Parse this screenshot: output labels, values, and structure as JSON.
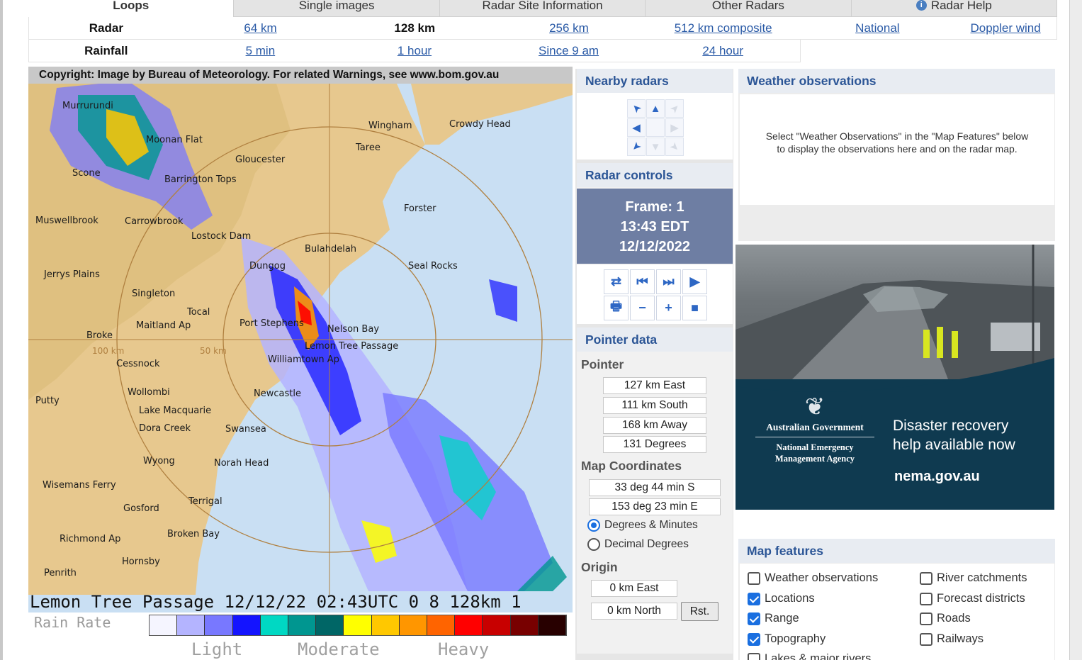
{
  "tabs": [
    {
      "label": "Loops",
      "active": true
    },
    {
      "label": "Single images",
      "active": false
    },
    {
      "label": "Radar Site Information",
      "active": false
    },
    {
      "label": "Other Radars",
      "active": false
    },
    {
      "label": "Radar Help",
      "active": false,
      "icon": "info-icon"
    }
  ],
  "radar_row": {
    "label": "Radar",
    "options": [
      "64 km",
      "128 km",
      "256 km",
      "512 km composite",
      "National",
      "Doppler wind"
    ],
    "current": "128 km"
  },
  "rainfall_row": {
    "label": "Rainfall",
    "options": [
      "5 min",
      "1 hour",
      "Since 9 am",
      "24 hour"
    ]
  },
  "radar_image": {
    "copyright": "Copyright: Image by Bureau of Meteorology. For related Warnings, see www.bom.gov.au",
    "footer": "Lemon Tree Passage 12/12/22 02:43UTC 0 8 128km 1",
    "range_labels": [
      "100 km",
      "50 km"
    ],
    "places": [
      "Murrurundi",
      "Moonan Flat",
      "Scone",
      "Barrington Tops",
      "Gloucester",
      "Wingham",
      "Taree",
      "Crowdy Head",
      "Forster",
      "Muswellbrook",
      "Carrowbrook",
      "Lostock Dam",
      "Bulahdelah",
      "Seal Rocks",
      "Jerrys Plains",
      "Dungog",
      "Singleton",
      "Tocal",
      "Maitland Ap",
      "Port Stephens",
      "Nelson Bay",
      "Broke",
      "Lemon Tree Passage",
      "Williamtown Ap",
      "Cessnock",
      "Wollombi",
      "Putty",
      "Newcastle",
      "Lake Macquarie",
      "Dora Creek",
      "Swansea",
      "Wyong",
      "Norah Head",
      "Wisemans Ferry",
      "Terrigal",
      "Gosford",
      "Richmond Ap",
      "Broken Bay",
      "Hornsby",
      "Penrith"
    ],
    "legend": {
      "title": "Rain Rate",
      "colors": [
        "#f5f5ff",
        "#b4b4ff",
        "#7878ff",
        "#1414ff",
        "#00d8c3",
        "#009690",
        "#006666",
        "#ffff00",
        "#ffc800",
        "#ff9600",
        "#ff6400",
        "#ff0000",
        "#c80000",
        "#780000",
        "#280000"
      ],
      "labels": [
        "Light",
        "Moderate",
        "Heavy"
      ]
    }
  },
  "nearby_radars": {
    "title": "Nearby radars",
    "cells": [
      {
        "icon": "arrow-northwest-icon",
        "glyph": "➤",
        "enabled": true
      },
      {
        "icon": "arrow-north-icon",
        "glyph": "▲",
        "enabled": true
      },
      {
        "icon": "arrow-northeast-icon",
        "glyph": "➤",
        "enabled": false
      },
      {
        "icon": "arrow-west-icon",
        "glyph": "◀",
        "enabled": true
      },
      {
        "icon": "center-icon",
        "glyph": "",
        "enabled": false
      },
      {
        "icon": "arrow-east-icon",
        "glyph": "▶",
        "enabled": false
      },
      {
        "icon": "arrow-southwest-icon",
        "glyph": "➤",
        "enabled": true
      },
      {
        "icon": "arrow-south-icon",
        "glyph": "▼",
        "enabled": false
      },
      {
        "icon": "arrow-southeast-icon",
        "glyph": "➤",
        "enabled": false
      }
    ]
  },
  "radar_controls": {
    "title": "Radar controls",
    "frame": "Frame: 1",
    "time": "13:43 EDT",
    "date": "12/12/2022",
    "buttons": [
      {
        "icon": "swap-icon",
        "glyph": "⇄"
      },
      {
        "icon": "first-frame-icon",
        "glyph": "⏮"
      },
      {
        "icon": "next-frame-icon",
        "glyph": "⏭"
      },
      {
        "icon": "play-icon",
        "glyph": "▶"
      },
      {
        "icon": "print-icon",
        "glyph": "🖶"
      },
      {
        "icon": "zoom-out-icon",
        "glyph": "−"
      },
      {
        "icon": "zoom-in-icon",
        "glyph": "+"
      },
      {
        "icon": "stop-icon",
        "glyph": "■"
      }
    ]
  },
  "pointer_data": {
    "title": "Pointer data",
    "pointer_label": "Pointer",
    "east": "127 km East",
    "south": "111 km South",
    "away": "168 km Away",
    "degrees": "131 Degrees",
    "map_coords_label": "Map Coordinates",
    "lat": "33 deg 44 min S",
    "lon": "153 deg 23 min E",
    "format_options": [
      "Degrees & Minutes",
      "Decimal Degrees"
    ],
    "selected_format": "Degrees & Minutes",
    "origin_label": "Origin",
    "origin_east": "0 km East",
    "origin_north": "0 km North",
    "reset_label": "Rst."
  },
  "weather_observations": {
    "title": "Weather observations",
    "message": "Select \"Weather Observations\" in the \"Map Features\" below to display the observations here and on the radar map."
  },
  "ad": {
    "gov_line1": "Australian Government",
    "gov_line2": "National Emergency Management Agency",
    "headline": "Disaster recovery help available now",
    "url": "nema.gov.au"
  },
  "map_features": {
    "title": "Map features",
    "left": [
      {
        "label": "Weather observations",
        "checked": false
      },
      {
        "label": "Locations",
        "checked": true
      },
      {
        "label": "Range",
        "checked": true
      },
      {
        "label": "Topography",
        "checked": true
      },
      {
        "label": "Lakes & major rivers",
        "checked": false
      }
    ],
    "right": [
      {
        "label": "River catchments",
        "checked": false
      },
      {
        "label": "Forecast districts",
        "checked": false
      },
      {
        "label": "Roads",
        "checked": false
      },
      {
        "label": "Railways",
        "checked": false
      }
    ]
  },
  "colors": {
    "panel_title": "#2b5596",
    "link": "#2a5aa6",
    "frame_box": "#6e7ea3",
    "ad_background": "#0f3a50"
  }
}
